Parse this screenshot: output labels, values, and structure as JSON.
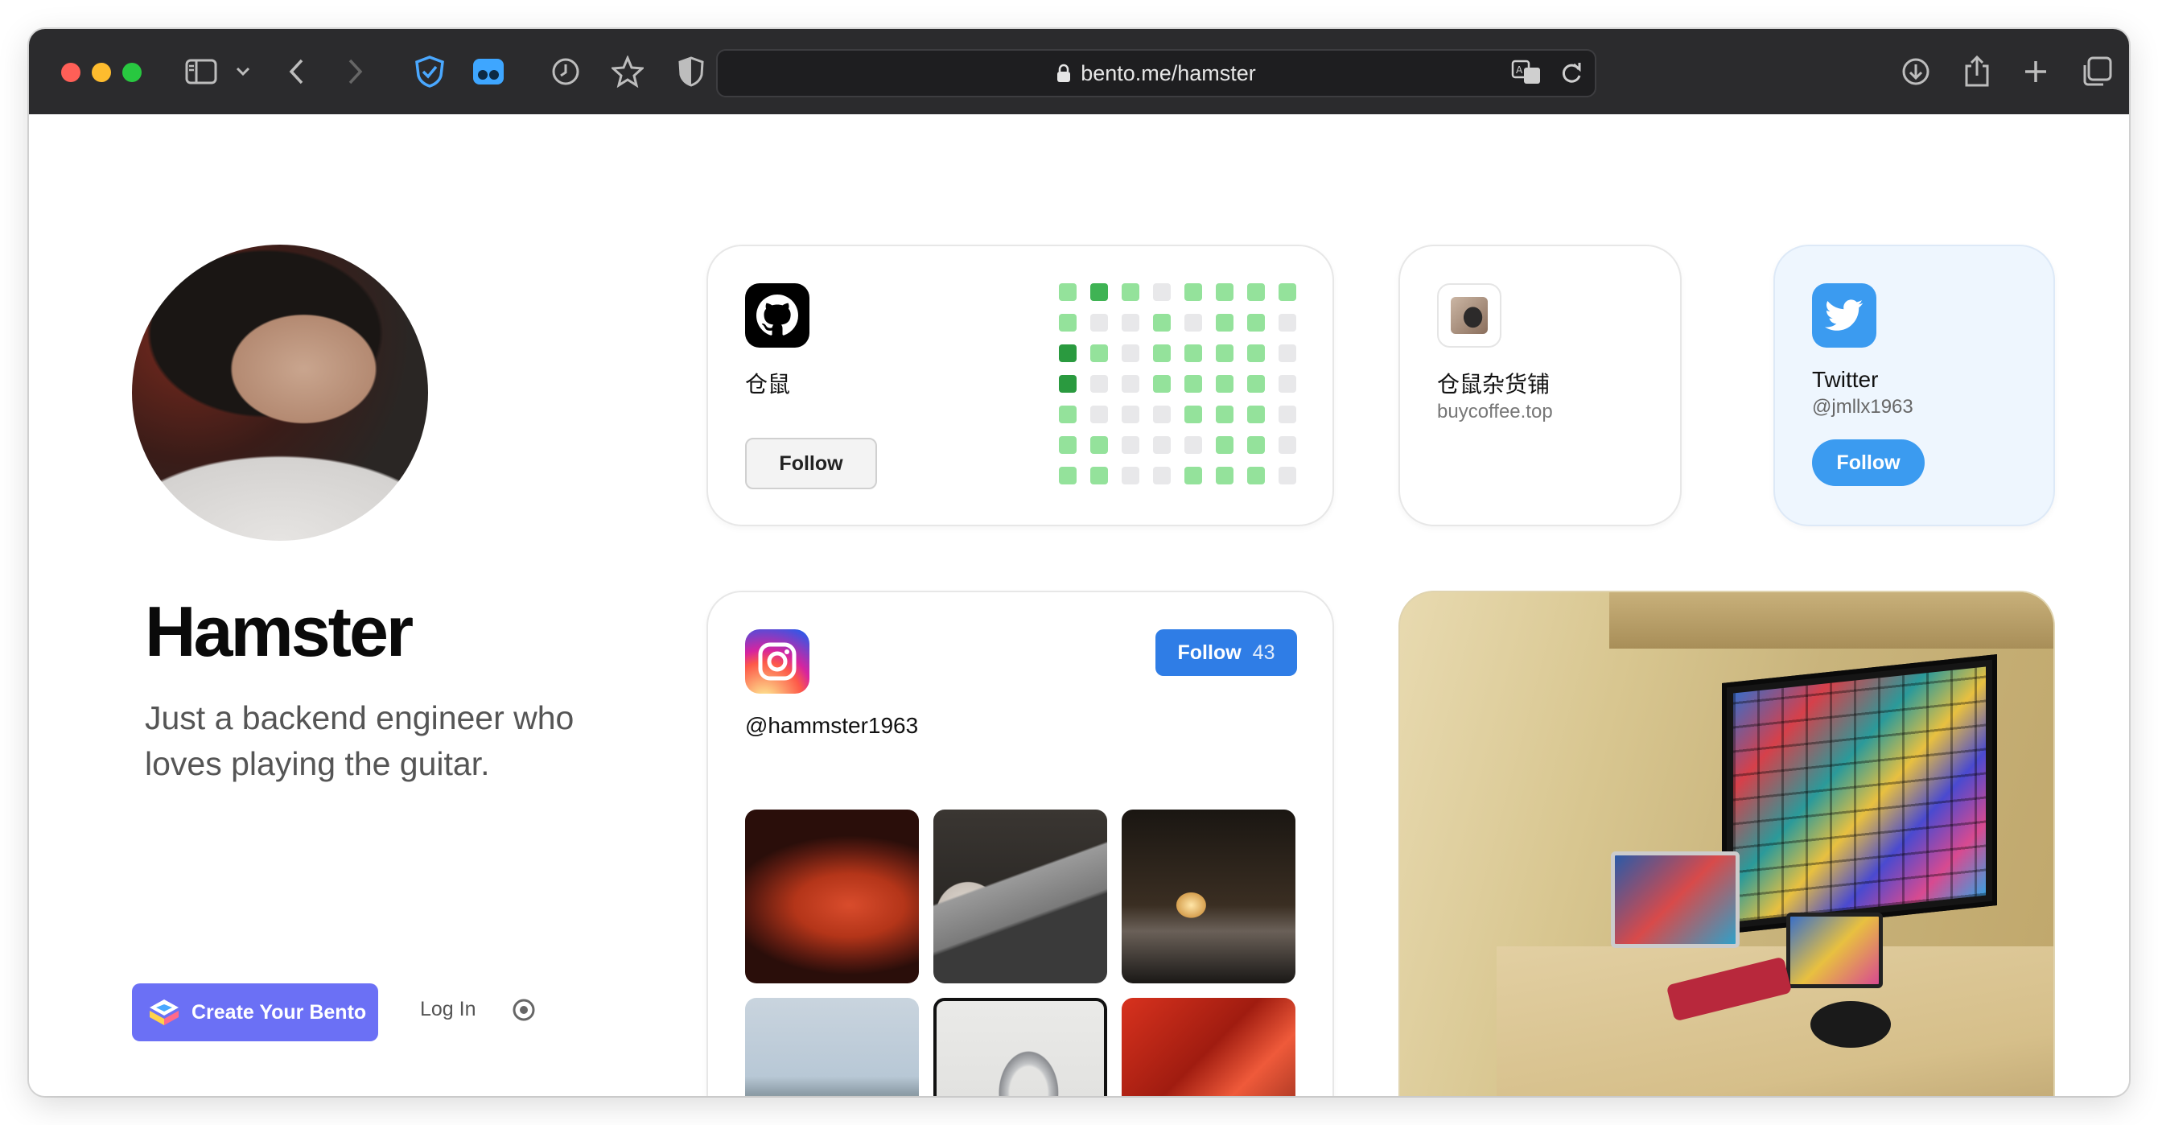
{
  "browser": {
    "url": "bento.me/hamster",
    "icons": [
      "sidebar-icon",
      "chevron-down-icon",
      "back-icon",
      "forward-icon",
      "shield-check-icon",
      "extension-icon",
      "history-icon",
      "star-icon",
      "privacy-shield-icon",
      "lock-icon",
      "translate-icon",
      "reload-icon",
      "download-icon",
      "share-icon",
      "new-tab-icon",
      "tabs-overview-icon"
    ]
  },
  "profile": {
    "name": "Hamster",
    "bio": "Just a backend engineer who loves playing the guitar."
  },
  "footer": {
    "create_label": "Create Your Bento",
    "login_label": "Log In"
  },
  "github": {
    "name": "仓鼠",
    "follow_label": "Follow",
    "contributions": [
      [
        1,
        3,
        1,
        0,
        1,
        1,
        1,
        1
      ],
      [
        1,
        0,
        0,
        1,
        0,
        1,
        1,
        0
      ],
      [
        4,
        1,
        0,
        1,
        1,
        1,
        1,
        0
      ],
      [
        4,
        0,
        0,
        1,
        1,
        1,
        1,
        0
      ],
      [
        1,
        0,
        0,
        0,
        1,
        1,
        1,
        0
      ],
      [
        1,
        1,
        0,
        0,
        0,
        1,
        1,
        0
      ],
      [
        1,
        1,
        0,
        0,
        1,
        1,
        1,
        0
      ]
    ]
  },
  "shop": {
    "name": "仓鼠杂货铺",
    "url": "buycoffee.top"
  },
  "twitter": {
    "name": "Twitter",
    "handle": "@jmllx1963",
    "follow_label": "Follow"
  },
  "instagram": {
    "handle": "@hammster1963",
    "follow_label": "Follow",
    "follow_count": "43"
  },
  "colors": {
    "accent": "#6b70f5",
    "twitter": "#3b9bf0",
    "instagram_button": "#2f7de6"
  }
}
